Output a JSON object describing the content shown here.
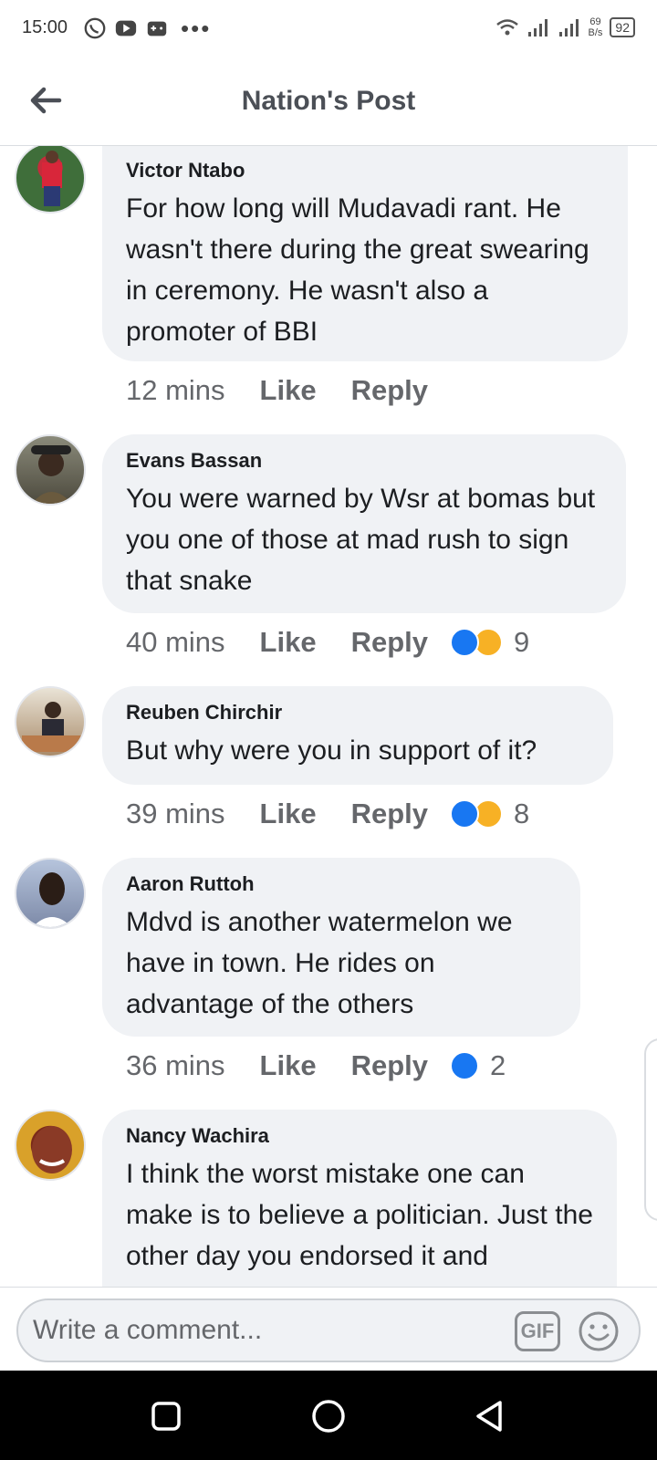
{
  "status_bar": {
    "time": "15:00",
    "speed_top": "69",
    "speed_bottom": "B/s",
    "battery": "92",
    "icons": [
      "whatsapp-icon",
      "youtube-icon",
      "game-icon",
      "more-dots-icon",
      "wifi-icon",
      "signal-icon",
      "signal-icon-2",
      "battery-icon"
    ]
  },
  "header": {
    "title": "Nation's Post",
    "back_icon": "back-arrow-icon"
  },
  "comments": [
    {
      "author": "Victor Ntabo",
      "text": "For how long will Mudavadi rant. He wasn't there during the great swearing in ceremony. He wasn't also a promoter of BBI",
      "time": "12 mins",
      "like_label": "Like",
      "reply_label": "Reply",
      "reactions": [],
      "reaction_count": ""
    },
    {
      "author": "Evans Bassan",
      "text": "You were warned by Wsr at bomas but you one of those at mad rush to sign that snake",
      "time": "40 mins",
      "like_label": "Like",
      "reply_label": "Reply",
      "reactions": [
        "like",
        "haha"
      ],
      "reaction_count": "9"
    },
    {
      "author": "Reuben Chirchir",
      "text": "But why were you in support of it?",
      "time": "39 mins",
      "like_label": "Like",
      "reply_label": "Reply",
      "reactions": [
        "like",
        "haha"
      ],
      "reaction_count": "8"
    },
    {
      "author": "Aaron Ruttoh",
      "text": "Mdvd is another watermelon we have in town. He rides on advantage of the others",
      "time": "36 mins",
      "like_label": "Like",
      "reply_label": "Reply",
      "reactions": [
        "like"
      ],
      "reaction_count": "2"
    },
    {
      "author": "Nancy Wachira",
      "text": "I think the worst mistake one can make is to believe a politician. Just the other day you endorsed it and",
      "time": "",
      "like_label": "",
      "reply_label": "",
      "reactions": [],
      "reaction_count": ""
    }
  ],
  "composer": {
    "placeholder": "Write a comment...",
    "gif_label": "GIF",
    "emoji_icon": "smiley-icon"
  },
  "nav_bar": {
    "icons": [
      "recent-apps-icon",
      "home-icon",
      "back-icon"
    ]
  },
  "colors": {
    "bubble": "#f0f2f5",
    "like_blue": "#1877f2",
    "haha_yellow": "#f7b125",
    "meta_grey": "#65676b"
  }
}
